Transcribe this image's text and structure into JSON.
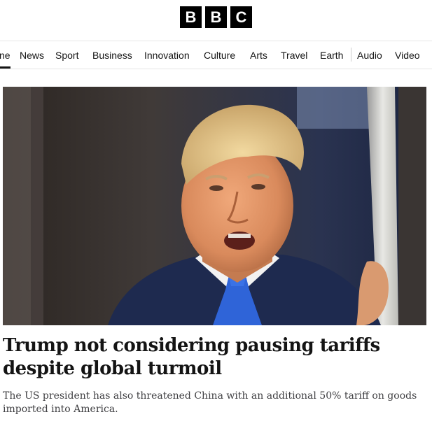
{
  "header": {
    "logo_letters": [
      "B",
      "B",
      "C"
    ]
  },
  "nav": {
    "items": [
      {
        "label": "Home",
        "visible_text": "ne",
        "active": true
      },
      {
        "label": "News"
      },
      {
        "label": "Sport"
      },
      {
        "label": "Business"
      },
      {
        "label": "Innovation"
      },
      {
        "label": "Culture"
      },
      {
        "label": "Arts"
      },
      {
        "label": "Travel"
      },
      {
        "label": "Earth"
      },
      {
        "label": "Audio"
      },
      {
        "label": "Video"
      }
    ]
  },
  "article": {
    "headline": "Trump not considering pausing tariffs despite global turmoil",
    "summary": "The US president has also threatened China with an additional 50% tariff on goods imported into America."
  },
  "colors": {
    "logo_bg": "#000000",
    "text": "#141414",
    "summary_text": "#3f3f42",
    "divider": "#e6e6e6"
  }
}
